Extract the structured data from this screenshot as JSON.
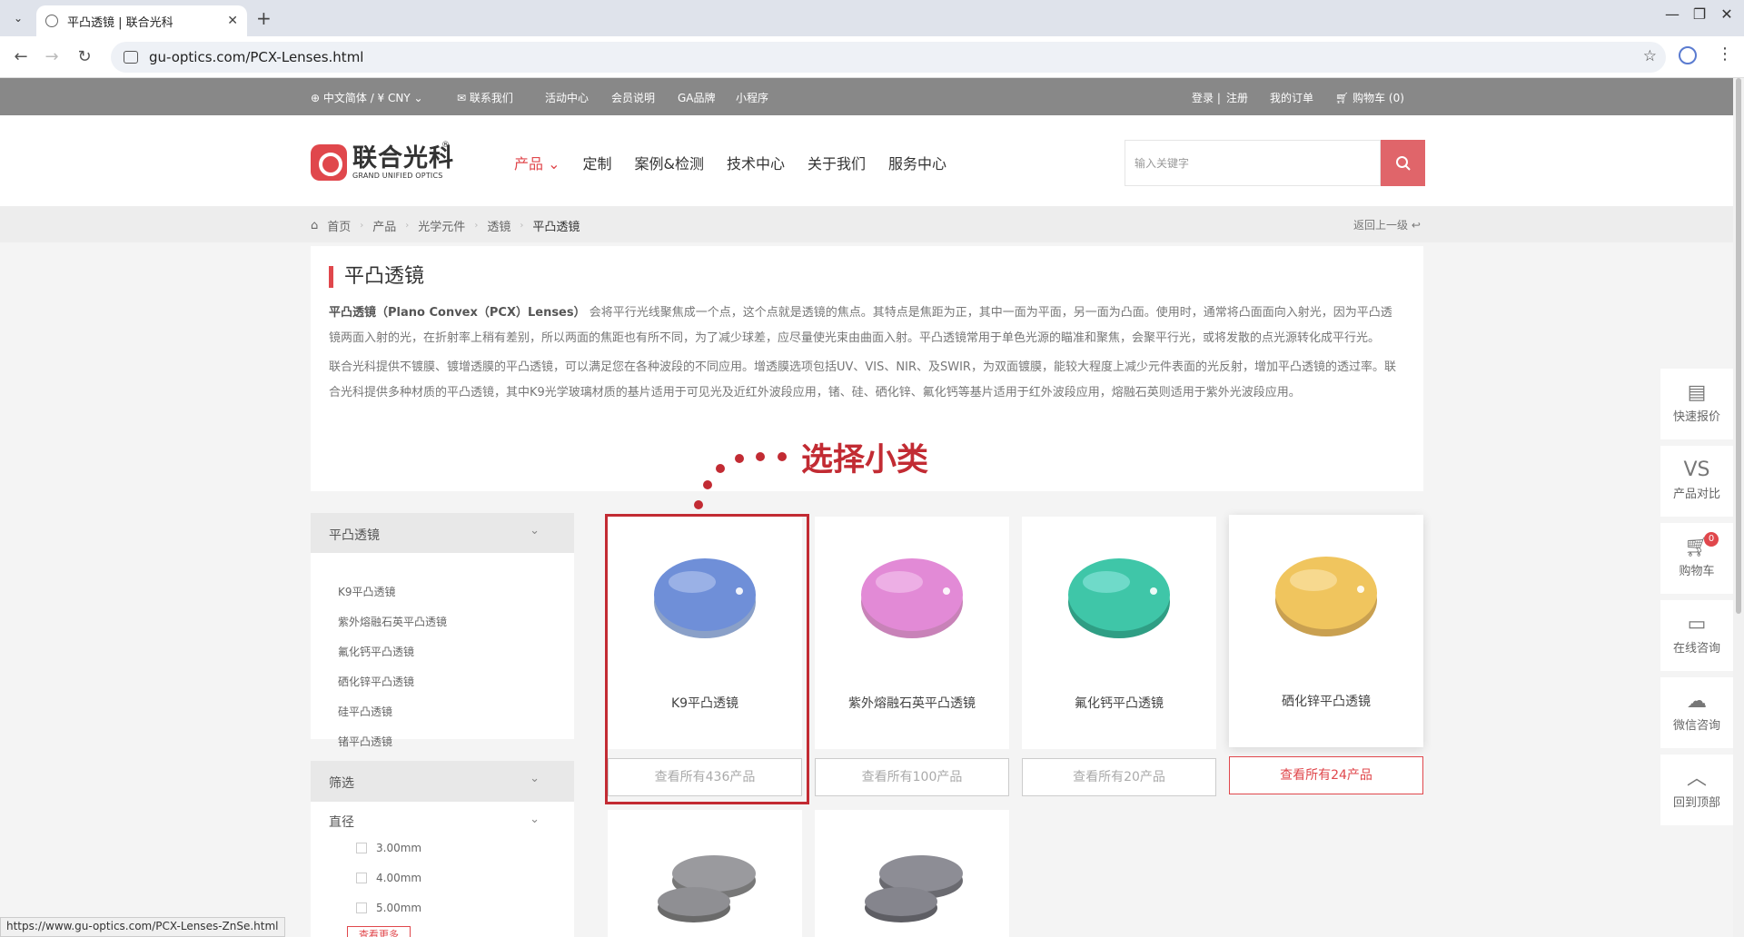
{
  "browser": {
    "tab_title": "平凸透镜 | 联合光科",
    "url": "gu-optics.com/PCX-Lenses.html",
    "status_url": "https://www.gu-optics.com/PCX-Lenses-ZnSe.html"
  },
  "topbar": {
    "lang": "中文简体 / ¥ CNY",
    "contact": "联系我们",
    "events": "活动中心",
    "member": "会员说明",
    "ga_brand": "GA品牌",
    "mini_program": "小程序",
    "login": "登录 |",
    "register": "注册",
    "my_orders": "我的订单",
    "cart": "购物车",
    "cart_count": "(0)"
  },
  "header": {
    "logo_cn": "联合光科",
    "logo_en": "GRAND UNIFIED OPTICS",
    "logo_registered": "®",
    "nav": [
      "产品",
      "定制",
      "案例&检测",
      "技术中心",
      "关于我们",
      "服务中心"
    ],
    "search_placeholder": "输入关键字"
  },
  "breadcrumb": {
    "items": [
      "首页",
      "产品",
      "光学元件",
      "透镜",
      "平凸透镜"
    ],
    "back": "返回上一级"
  },
  "intro": {
    "title": "平凸透镜",
    "lead": "平凸透镜（Plano Convex（PCX）Lenses）",
    "p1": "会将平行光线聚焦成一个点，这个点就是透镜的焦点。其特点是焦距为正，其中一面为平面，另一面为凸面。使用时，通常将凸面面向入射光，因为平凸透镜两面入射的光，在折射率上稍有差别，所以两面的焦距也有所不同，为了减少球差，应尽量使光束由曲面入射。平凸透镜常用于单色光源的瞄准和聚焦，会聚平行光，或将发散的点光源转化成平行光。",
    "p2": "联合光科提供不镀膜、镀增透膜的平凸透镜，可以满足您在各种波段的不同应用。增透膜选项包括UV、VIS、NIR、及SWIR，为双面镀膜，能较大程度上减少元件表面的光反射，增加平凸透镜的透过率。联合光科提供多种材质的平凸透镜，其中K9光学玻璃材质的基片适用于可见光及近红外波段应用，锗、硅、硒化锌、氟化钙等基片适用于红外波段应用，熔融石英则适用于紫外光波段应用。"
  },
  "annotation": "选择小类",
  "sidebar": {
    "category_title": "平凸透镜",
    "items": [
      "K9平凸透镜",
      "紫外熔融石英平凸透镜",
      "氟化钙平凸透镜",
      "硒化锌平凸透镜",
      "硅平凸透镜",
      "锗平凸透镜"
    ],
    "filter_title": "筛选",
    "diameter_title": "直径",
    "diameters": [
      "3.00mm",
      "4.00mm",
      "5.00mm"
    ],
    "more": "查看更多"
  },
  "products": [
    {
      "name": "K9平凸透镜",
      "view_all": "查看所有436产品",
      "color": "#6f8fd8"
    },
    {
      "name": "紫外熔融石英平凸透镜",
      "view_all": "查看所有100产品",
      "color": "#e28ad6"
    },
    {
      "name": "氟化钙平凸透镜",
      "view_all": "查看所有20产品",
      "color": "#3fc6a8"
    },
    {
      "name": "硒化锌平凸透镜",
      "view_all": "查看所有24产品",
      "color": "#f0c55e"
    }
  ],
  "float_toolbar": {
    "quote": "快速报价",
    "compare_icon": "VS",
    "compare": "产品对比",
    "cart": "购物车",
    "cart_badge": "0",
    "online": "在线咨询",
    "wechat": "微信咨询",
    "top": "回到顶部"
  },
  "colors": {
    "accent": "#e0474c",
    "annotation": "#c22b33"
  }
}
